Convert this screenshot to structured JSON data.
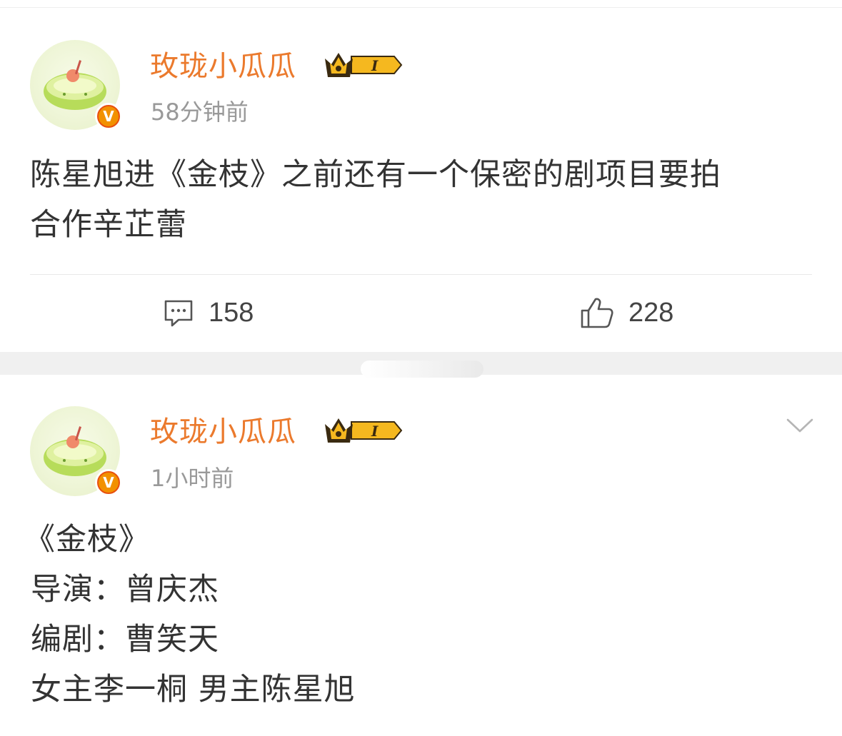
{
  "posts": [
    {
      "username": "玫珑小瓜瓜",
      "level": "I",
      "time": "58分钟前",
      "content_lines": [
        "陈星旭进《金枝》之前还有一个保密的剧项目要拍",
        "合作辛芷蕾"
      ],
      "comment_count": "158",
      "like_count": "228"
    },
    {
      "username": "玫珑小瓜瓜",
      "level": "I",
      "time": "1小时前",
      "content_lines": [
        "《金枝》",
        "导演：曾庆杰",
        "编剧：曹笑天",
        "女主李一桐 男主陈星旭"
      ]
    }
  ],
  "colors": {
    "username": "#eb7a2d",
    "time": "#999999",
    "text": "#333333",
    "verified_badge": "#f29100",
    "crown_gold": "#f5b81f"
  },
  "icons": {
    "verified": "v-verified-badge",
    "crown": "crown-level-icon",
    "comment": "comment-icon",
    "like": "thumbs-up-icon",
    "more": "chevron-down-icon"
  }
}
